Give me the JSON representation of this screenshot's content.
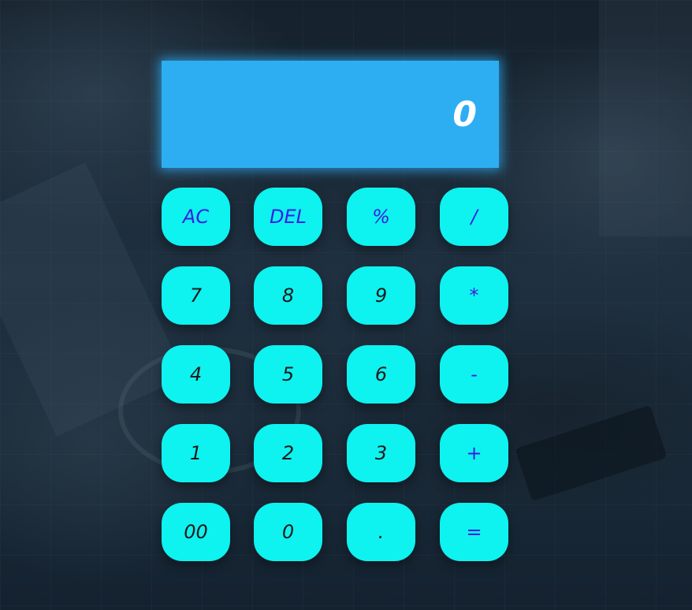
{
  "display": {
    "value": "0"
  },
  "keys": {
    "ac": "AC",
    "del": "DEL",
    "percent": "%",
    "divide": "/",
    "seven": "7",
    "eight": "8",
    "nine": "9",
    "multiply": "*",
    "four": "4",
    "five": "5",
    "six": "6",
    "minus": "-",
    "one": "1",
    "two": "2",
    "three": "3",
    "plus": "+",
    "double_zero": "00",
    "zero": "0",
    "decimal": ".",
    "equals": "="
  },
  "colors": {
    "display_bg": "#2eaef2",
    "key_bg": "#0ef2f0",
    "operator_text": "#3a1ee0",
    "number_text": "#1a1a1a"
  }
}
